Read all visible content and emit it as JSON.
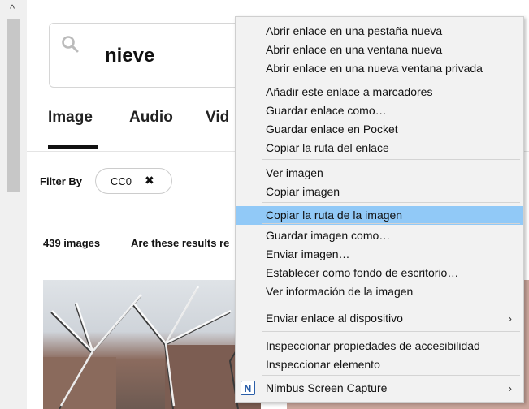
{
  "search": {
    "query": "nieve"
  },
  "tabs": [
    {
      "label": "Image"
    },
    {
      "label": "Audio"
    },
    {
      "label": "Vid"
    }
  ],
  "filter": {
    "label": "Filter By",
    "chip": "CC0",
    "chip_close": "✖"
  },
  "results": {
    "count": "439 images",
    "question": "Are these results re"
  },
  "scrollbar": {
    "up_arrow": "^"
  },
  "context_menu": {
    "items": [
      {
        "label": "Abrir enlace en una pestaña nueva"
      },
      {
        "label": "Abrir enlace en una ventana nueva"
      },
      {
        "label": "Abrir enlace en una nueva ventana privada"
      },
      {
        "label": "Añadir este enlace a marcadores"
      },
      {
        "label": "Guardar enlace como…"
      },
      {
        "label": "Guardar enlace en Pocket"
      },
      {
        "label": "Copiar la ruta del enlace"
      },
      {
        "label": "Ver imagen"
      },
      {
        "label": "Copiar imagen"
      },
      {
        "label": "Copiar la ruta de la imagen",
        "highlighted": true
      },
      {
        "label": "Guardar imagen como…"
      },
      {
        "label": "Enviar imagen…"
      },
      {
        "label": "Establecer como fondo de escritorio…"
      },
      {
        "label": "Ver información de la imagen"
      },
      {
        "label": "Enviar enlace al dispositivo",
        "submenu": "›"
      },
      {
        "label": "Inspeccionar propiedades de accesibilidad"
      },
      {
        "label": "Inspeccionar elemento"
      },
      {
        "label": "Nimbus Screen Capture",
        "submenu": "›",
        "icon": "N"
      }
    ],
    "highlight_color": "#91c9f7"
  }
}
